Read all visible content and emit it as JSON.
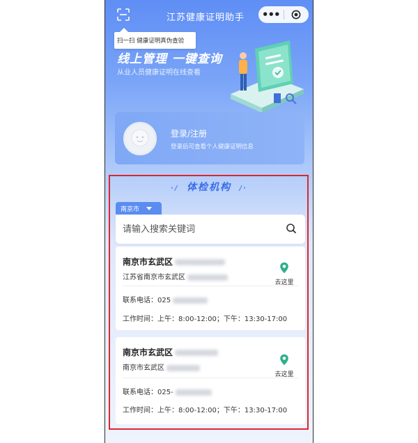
{
  "app": {
    "title": "江苏健康证明助手",
    "scan_icon": "scan-icon",
    "more_icon": "more-dots-icon",
    "record_icon": "record-icon"
  },
  "tooltip": "扫一扫 健康证明真伪查验",
  "banner": {
    "title": "线上管理  一键查询",
    "subtitle": "从业人员健康证明在线查看"
  },
  "login": {
    "title": "登录/注册",
    "description": "登录后可查看个人健康证明信息"
  },
  "section": {
    "title": "体检机构",
    "deco_left": "·/ ",
    "deco_right": " /·"
  },
  "city_filter": {
    "selected": "南京市"
  },
  "search": {
    "placeholder": "请输入搜索关键词",
    "value": ""
  },
  "institutions": [
    {
      "name": "南京市玄武区",
      "address": "江苏省南京市玄武区",
      "phone_label": "联系电话：",
      "phone": "025",
      "hours_label": "工作时间：",
      "hours": "上午：8:00-12:00；下午：13:30-17:00",
      "go_label": "去这里"
    },
    {
      "name": "南京市玄武区",
      "address": "南京市玄武区",
      "phone_label": "联系电话：",
      "phone": "025-",
      "hours_label": "工作时间：",
      "hours": "上午：8:00-12:00；下午：13:30-17:00",
      "go_label": "去这里"
    }
  ],
  "colors": {
    "accent": "#5b8cf1",
    "highlight": "#d9282f",
    "pin": "#2fb08a"
  }
}
